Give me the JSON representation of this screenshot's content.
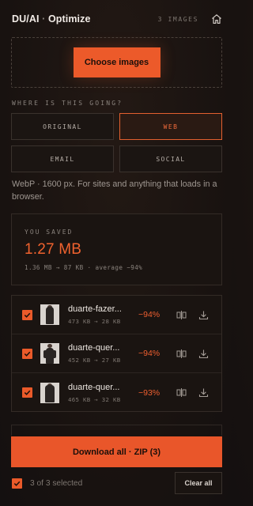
{
  "header": {
    "brand": "DU/AI",
    "separator": " · ",
    "title": "Optimize",
    "image_count": "3 IMAGES",
    "home_icon": "home-icon"
  },
  "upload": {
    "button_label": "Choose images"
  },
  "destination": {
    "label": "WHERE IS THIS GOING?",
    "options": [
      "ORIGINAL",
      "WEB",
      "EMAIL",
      "SOCIAL"
    ],
    "selected": "WEB",
    "description": "WebP · 1600 px. For sites and anything that loads in a browser."
  },
  "savings": {
    "label": "YOU SAVED",
    "value": "1.27 MB",
    "detail": "1.36 MB → 87 KB · average −94%"
  },
  "files": [
    {
      "name": "duarte-fazer...",
      "sizes": "473 KB → 28 KB",
      "reduction": "−94%",
      "checked": true
    },
    {
      "name": "duarte-quer...",
      "sizes": "452 KB → 27 KB",
      "reduction": "−94%",
      "checked": true
    },
    {
      "name": "duarte-quer...",
      "sizes": "465 KB → 32 KB",
      "reduction": "−93%",
      "checked": true
    }
  ],
  "actions": {
    "download_label": "Download all · ZIP (3)",
    "selected_text": "3 of 3 selected",
    "clear_label": "Clear all"
  },
  "colors": {
    "accent": "#ec5a2a",
    "background": "#181210",
    "text": "#e9e2dc",
    "muted": "#8a837d"
  }
}
